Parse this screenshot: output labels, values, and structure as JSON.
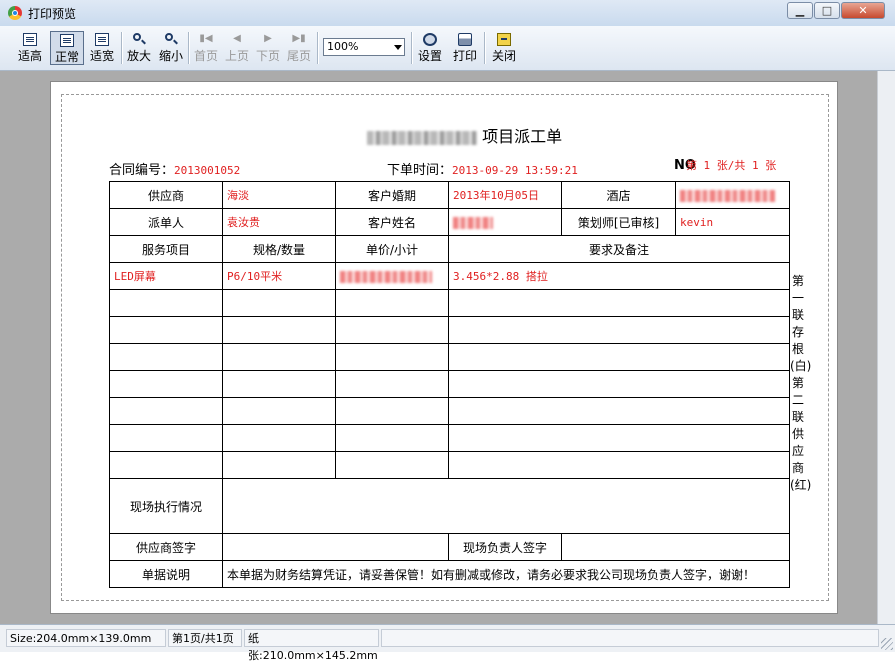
{
  "window": {
    "title": "打印预览",
    "min_label": "▁",
    "max_label": "□",
    "close_label": "✕"
  },
  "toolbar": {
    "fit_height": "适高",
    "normal": "正常",
    "fit_width": "适宽",
    "zoom_in": "放大",
    "zoom_out": "缩小",
    "first_page": "首页",
    "prev_page": "上页",
    "next_page": "下页",
    "last_page": "尾页",
    "zoom_value": "100%",
    "setup": "设置",
    "print": "打印",
    "close": "关闭"
  },
  "form": {
    "title_suffix": "项目派工单",
    "contract_label": "合同编号：",
    "contract_no": "2013001052",
    "order_time_label": "下单时间：",
    "order_time": "2013-09-29 13:59:21",
    "no_label": "NO",
    "sheet_info": "第 1 张/共 1 张",
    "row1": {
      "supplier_label": "供应商",
      "supplier": "海淡",
      "wedding_date_label": "客户婚期",
      "wedding_date": "2013年10月05日",
      "hotel_label": "酒店"
    },
    "row2": {
      "dispatcher_label": "派单人",
      "dispatcher": "袁汝贵",
      "customer_label": "客户姓名",
      "planner_label": "策划师[已审核]",
      "planner": "kevin"
    },
    "header": {
      "service": "服务项目",
      "spec": "规格/数量",
      "price": "单价/小计",
      "remarks": "要求及备注"
    },
    "item": {
      "service": "LED屏幕",
      "spec": "P6/10平米",
      "remarks": "3.456*2.88  搭拉"
    },
    "execution_label": "现场执行情况",
    "supplier_sign_label": "供应商签字",
    "site_sign_label": "现场负责人签字",
    "note_label": "单据说明",
    "note_text": "本单据为财务结算凭证，请妥善保管！如有删减或修改，请务必要求我公司现场负责人签字，谢谢！",
    "side_label": "第一联存根(白)第二联供应商(红)"
  },
  "status": {
    "size": "Size:204.0mm×139.0mm",
    "page": "第1页/共1页",
    "paper": "纸张:210.0mm×145.2mm"
  }
}
